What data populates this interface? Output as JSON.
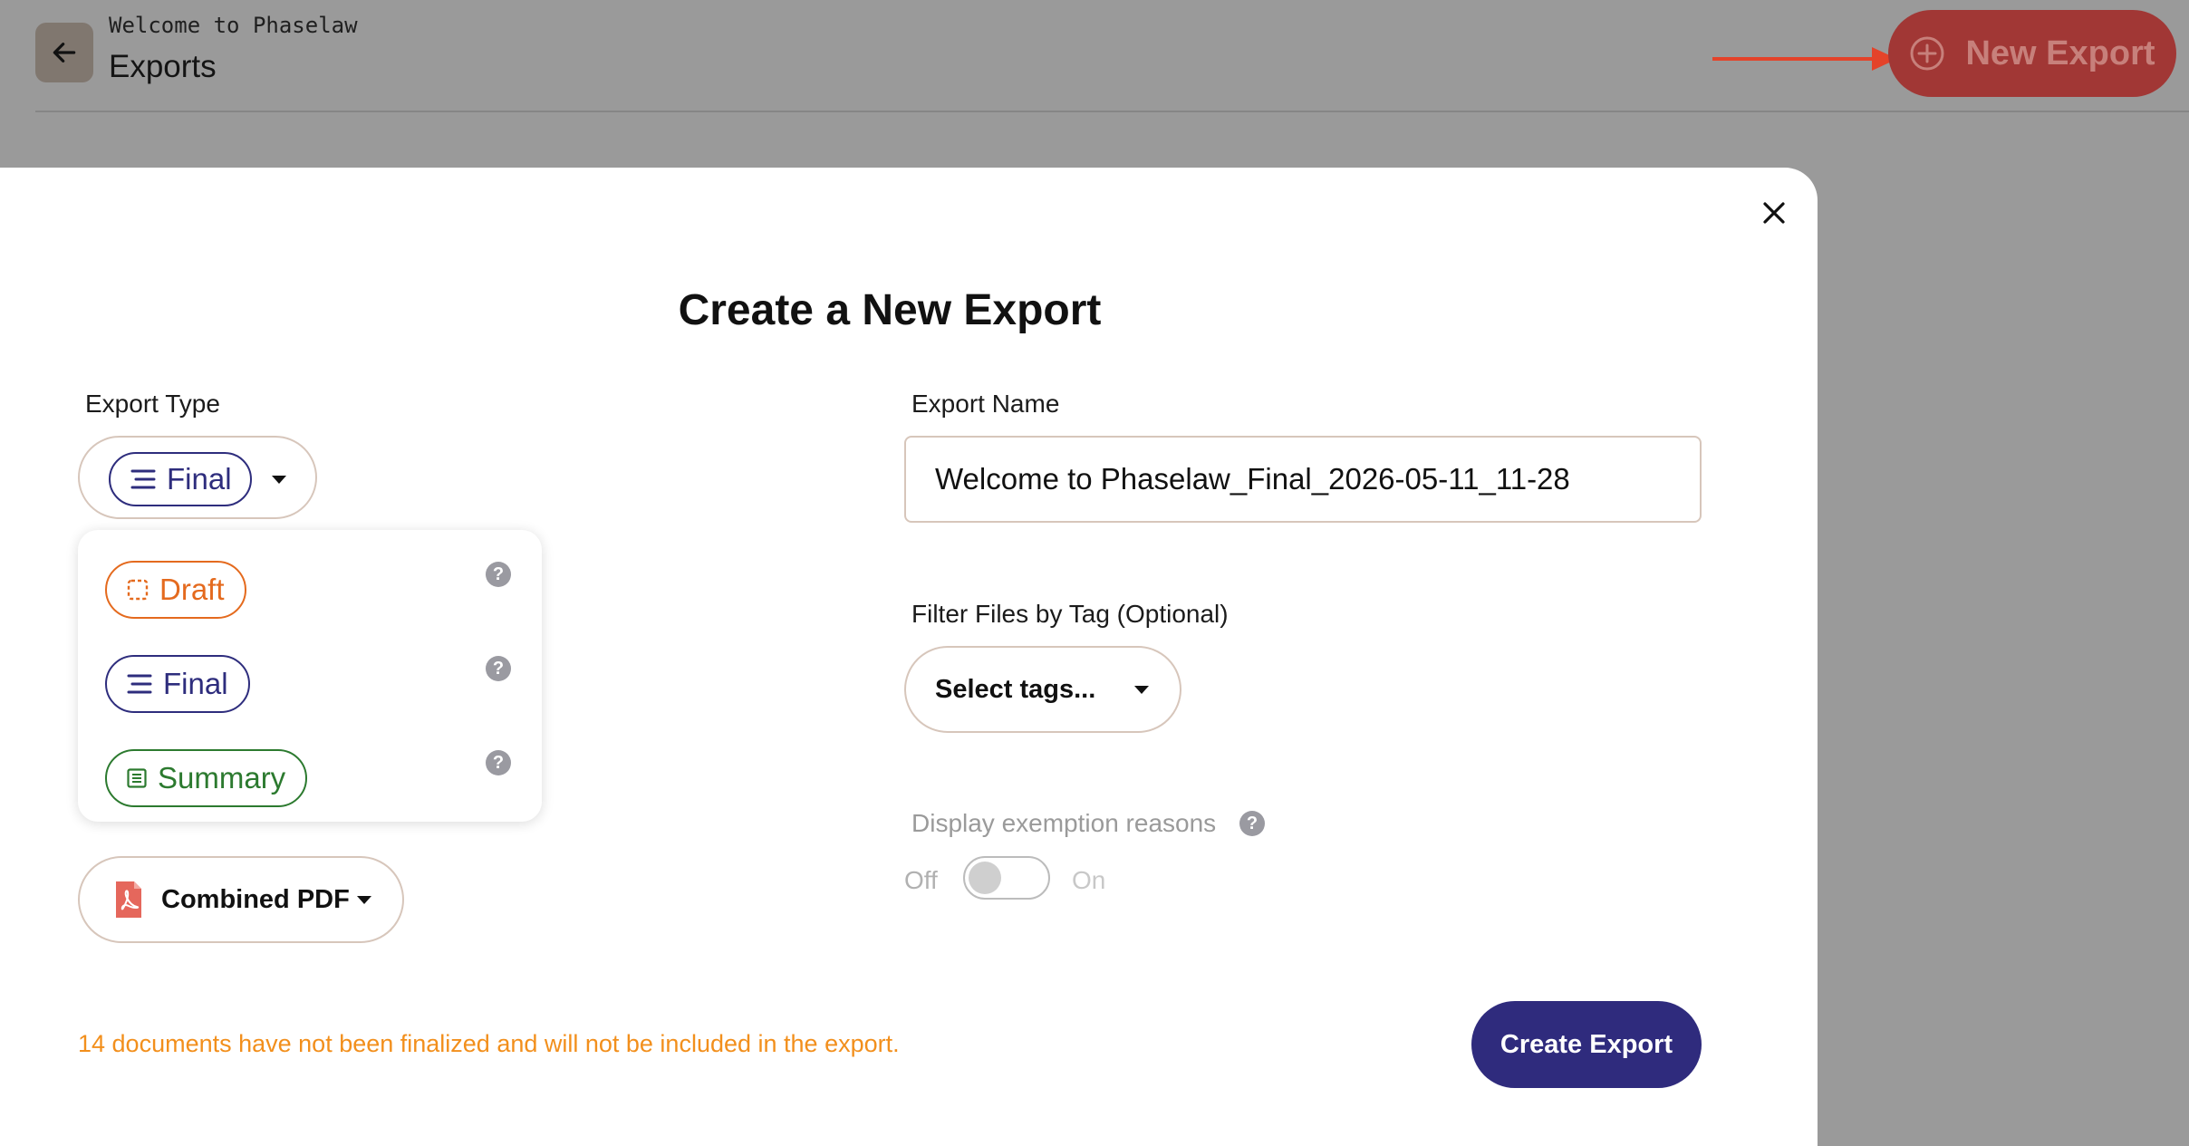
{
  "header": {
    "project_name": "Welcome to Phaselaw",
    "page_title": "Exports",
    "new_export_label": "New Export"
  },
  "modal": {
    "title": "Create a New Export",
    "export_type": {
      "label": "Export Type",
      "selected": "Final",
      "options": [
        {
          "label": "Draft",
          "color": "#e46a1e",
          "icon": "dashed-square-icon"
        },
        {
          "label": "Final",
          "color": "#2e2d7d",
          "icon": "lines-icon"
        },
        {
          "label": "Summary",
          "color": "#2c7a2f",
          "icon": "list-icon"
        }
      ]
    },
    "export_name": {
      "label": "Export Name",
      "value": "Welcome to Phaselaw_Final_2026-05-11_11-28"
    },
    "tag_filter": {
      "label": "Filter Files by Tag (Optional)",
      "placeholder": "Select tags..."
    },
    "format": {
      "selected": "Combined PDF",
      "icon": "pdf-file-icon"
    },
    "exemption": {
      "label": "Display exemption reasons",
      "off_label": "Off",
      "on_label": "On",
      "enabled": false
    },
    "warning": "14 documents have not been finalized and will not be included in the export.",
    "create_label": "Create Export"
  },
  "colors": {
    "primary": "#2f2b7d",
    "accent_red": "#e4432a",
    "warning": "#f28f1c"
  }
}
